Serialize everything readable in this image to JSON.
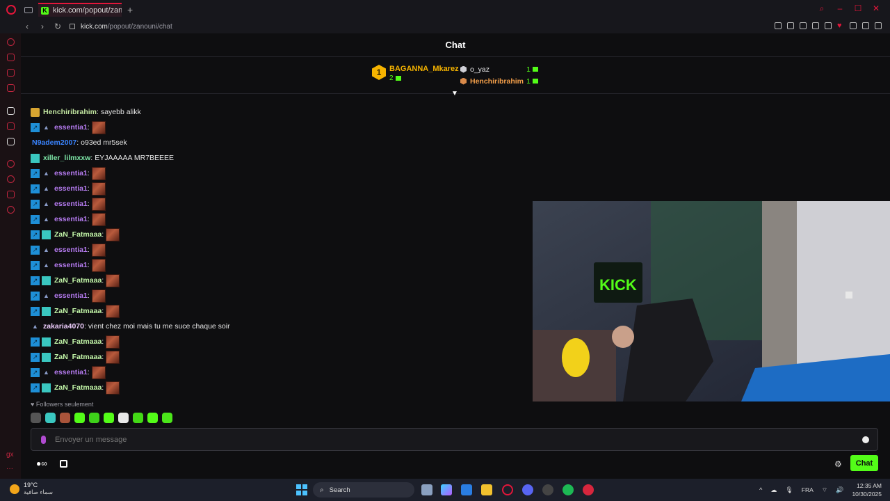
{
  "browser": {
    "tab_title": "kick.com/popout/zanouni",
    "url_domain": "kick.com",
    "url_path": "/popout/zanouni/chat"
  },
  "chat": {
    "header_title": "Chat",
    "leaderboard": {
      "first": {
        "rank": "1",
        "name": "BAGANNA_Mkarez",
        "count": "2"
      },
      "second": {
        "name": "o_yaz",
        "count": "1"
      },
      "third": {
        "name": "Henchiribrahim",
        "count": "1"
      }
    },
    "messages": [
      {
        "badges": [
          "gold"
        ],
        "user": "Henchiribrahim",
        "color": "#c2e6a1",
        "text": "sayebb alikk",
        "emote": false
      },
      {
        "badges": [
          "og",
          "vip"
        ],
        "user": "essentia1",
        "color": "#b57bf0",
        "text": "",
        "emote": true
      },
      {
        "badges": [],
        "user": "N9adem2007",
        "color": "#3a84ff",
        "text": "o93ed mr5sek",
        "emote": false
      },
      {
        "badges": [
          "sub"
        ],
        "user": "xiller_lilmxxw",
        "color": "#7ee8a8",
        "text": "EYJAAAAA MR7BEEEE",
        "emote": false
      },
      {
        "badges": [
          "og",
          "vip"
        ],
        "user": "essentia1",
        "color": "#b57bf0",
        "text": "",
        "emote": true
      },
      {
        "badges": [
          "og",
          "vip"
        ],
        "user": "essentia1",
        "color": "#b57bf0",
        "text": "",
        "emote": true
      },
      {
        "badges": [
          "og",
          "vip"
        ],
        "user": "essentia1",
        "color": "#b57bf0",
        "text": "",
        "emote": true
      },
      {
        "badges": [
          "og",
          "vip"
        ],
        "user": "essentia1",
        "color": "#b57bf0",
        "text": "",
        "emote": true
      },
      {
        "badges": [
          "og",
          "sub"
        ],
        "user": "ZaN_Fatmaaa",
        "color": "#c2f5a8",
        "text": "",
        "emote": true
      },
      {
        "badges": [
          "og",
          "vip"
        ],
        "user": "essentia1",
        "color": "#b57bf0",
        "text": "",
        "emote": true
      },
      {
        "badges": [
          "og",
          "vip"
        ],
        "user": "essentia1",
        "color": "#b57bf0",
        "text": "",
        "emote": true
      },
      {
        "badges": [
          "og",
          "sub"
        ],
        "user": "ZaN_Fatmaaa",
        "color": "#c2f5a8",
        "text": "",
        "emote": true
      },
      {
        "badges": [
          "og",
          "vip"
        ],
        "user": "essentia1",
        "color": "#b57bf0",
        "text": "",
        "emote": true
      },
      {
        "badges": [
          "og",
          "sub"
        ],
        "user": "ZaN_Fatmaaa",
        "color": "#c2f5a8",
        "text": "",
        "emote": true
      },
      {
        "badges": [
          "vip"
        ],
        "user": "zakaria4070",
        "color": "#f0d0ff",
        "text": "vient chez moi mais tu me suce chaque soir",
        "emote": false
      },
      {
        "badges": [
          "og",
          "sub"
        ],
        "user": "ZaN_Fatmaaa",
        "color": "#c2f5a8",
        "text": "",
        "emote": true
      },
      {
        "badges": [
          "og",
          "sub"
        ],
        "user": "ZaN_Fatmaaa",
        "color": "#c2f5a8",
        "text": "",
        "emote": true
      },
      {
        "badges": [
          "og",
          "vip"
        ],
        "user": "essentia1",
        "color": "#b57bf0",
        "text": "",
        "emote": true
      },
      {
        "badges": [
          "og",
          "sub"
        ],
        "user": "ZaN_Fatmaaa",
        "color": "#c2f5a8",
        "text": "",
        "emote": true
      }
    ],
    "followers_only_label": "Followers seulement",
    "input_placeholder": "Envoyer un message",
    "send_button_label": "Chat",
    "video_overlay_text": "KICK"
  },
  "taskbar": {
    "temperature": "19°C",
    "weather_condition": "سماء صافية",
    "search_label": "Search",
    "language": "FRA",
    "time": "12:35 AM",
    "date": "10/30/2025"
  },
  "colors": {
    "accent": "#53fc18",
    "browser_red": "#e3163a"
  }
}
